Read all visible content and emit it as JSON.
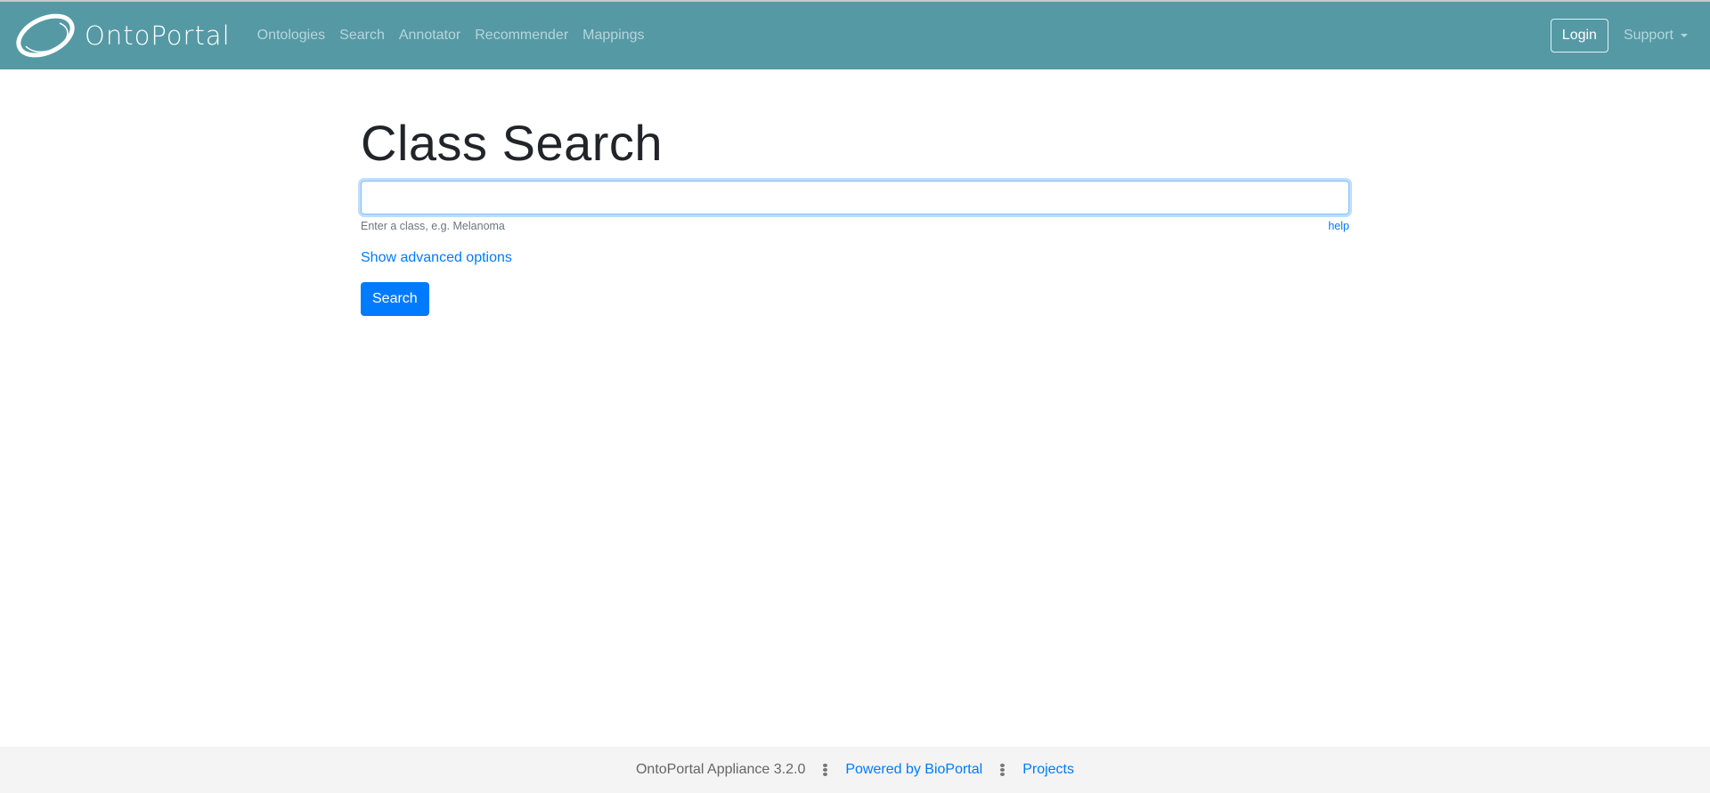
{
  "header": {
    "brand": "OntoPortal",
    "brand_icon": "ontoportal-logo-icon",
    "nav": [
      {
        "label": "Ontologies"
      },
      {
        "label": "Search"
      },
      {
        "label": "Annotator"
      },
      {
        "label": "Recommender"
      },
      {
        "label": "Mappings"
      }
    ],
    "login_label": "Login",
    "support_label": "Support",
    "support_icon": "caret-down-icon"
  },
  "main": {
    "title": "Class Search",
    "search_input": {
      "value": "",
      "placeholder": ""
    },
    "helper_text": "Enter a class, e.g. Melanoma",
    "help_link": "help",
    "advanced_link": "Show advanced options",
    "search_button": "Search"
  },
  "footer": {
    "version_text": "OntoPortal Appliance 3.2.0",
    "separator_icon": "vertical-dots-icon",
    "powered_link": "Powered by BioPortal",
    "projects_link": "Projects"
  },
  "colors": {
    "navbar": "#5599a4",
    "nav_link": "#b6d6db",
    "primary": "#007bff",
    "footer_bg": "#f4f4f4"
  }
}
